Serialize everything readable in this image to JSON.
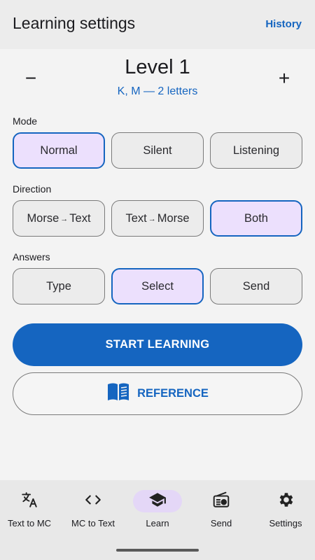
{
  "appbar": {
    "title": "Learning settings",
    "history_label": "History"
  },
  "level": {
    "minus": "−",
    "plus": "+",
    "title": "Level 1",
    "subtitle": "K, M — 2 letters"
  },
  "mode": {
    "label": "Mode",
    "options": [
      "Normal",
      "Silent",
      "Listening"
    ],
    "selected": "Normal"
  },
  "direction": {
    "label": "Direction",
    "options": [
      {
        "from": "Morse",
        "arrow": "→",
        "to": "Text"
      },
      {
        "from": "Text",
        "arrow": "→",
        "to": "Morse"
      },
      {
        "label": "Both"
      }
    ],
    "selected": "Both"
  },
  "answers": {
    "label": "Answers",
    "options": [
      "Type",
      "Select",
      "Send"
    ],
    "selected": "Select"
  },
  "actions": {
    "start_label": "START LEARNING",
    "reference_label": "REFERENCE"
  },
  "nav": {
    "items": [
      {
        "label": "Text to MC",
        "icon": "translate-icon"
      },
      {
        "label": "MC to Text",
        "icon": "code-icon"
      },
      {
        "label": "Learn",
        "icon": "school-icon"
      },
      {
        "label": "Send",
        "icon": "radio-icon"
      },
      {
        "label": "Settings",
        "icon": "gear-icon"
      }
    ],
    "active": "Learn"
  },
  "colors": {
    "accent": "#1565c0",
    "selected_fill": "#ece0fd",
    "nav_active": "#e4d7f7"
  }
}
